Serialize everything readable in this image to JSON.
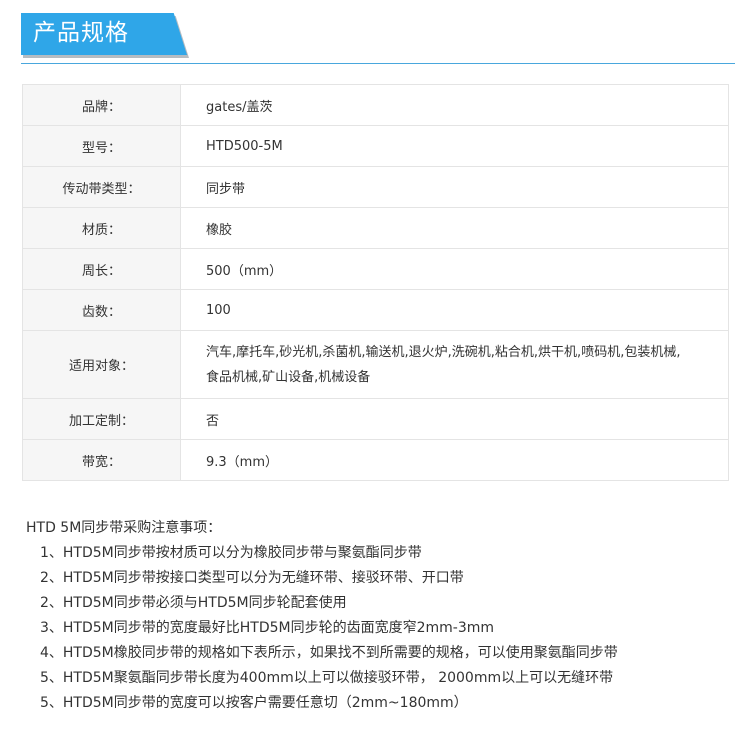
{
  "header": {
    "title": "产品规格"
  },
  "spec_rows": [
    {
      "label": "品牌：",
      "value": "gates/盖茨"
    },
    {
      "label": "型号：",
      "value": "HTD500-5M"
    },
    {
      "label": "传动带类型：",
      "value": "同步带"
    },
    {
      "label": "材质：",
      "value": "橡胶"
    },
    {
      "label": "周长：",
      "value": "500（mm）"
    },
    {
      "label": "齿数：",
      "value": "100"
    },
    {
      "label": "适用对象：",
      "value_lines": [
        "汽车,摩托车,砂光机,杀菌机,输送机,退火炉,洗碗机,粘合机,烘干机,喷码机,包装机械,",
        "食品机械,矿山设备,机械设备"
      ]
    },
    {
      "label": "加工定制：",
      "value": "否"
    },
    {
      "label": "带宽：",
      "value": "9.3（mm）"
    }
  ],
  "notes": {
    "intro": "HTD 5M同步带采购注意事项：",
    "items": [
      "1、HTD5M同步带按材质可以分为橡胶同步带与聚氨酯同步带",
      "2、HTD5M同步带按接口类型可以分为无缝环带、接驳环带、开口带",
      "2、HTD5M同步带必须与HTD5M同步轮配套使用",
      "3、HTD5M同步带的宽度最好比HTD5M同步轮的齿面宽度窄2mm-3mm",
      "4、HTD5M橡胶同步带的规格如下表所示，如果找不到所需要的规格，可以使用聚氨酯同步带",
      "5、HTD5M聚氨酯同步带长度为400mm以上可以做接驳环带， 2000mm以上可以无缝环带",
      "5、HTD5M同步带的宽度可以按客户需要任意切（2mm~180mm）"
    ]
  }
}
